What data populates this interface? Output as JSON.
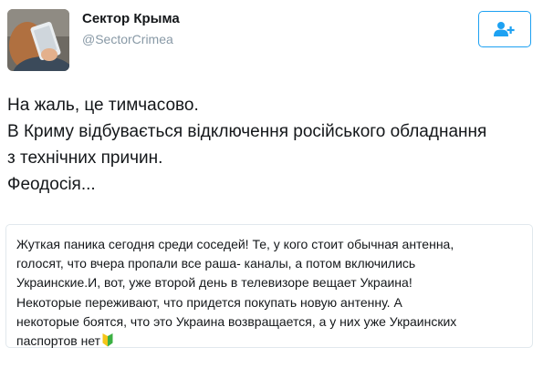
{
  "author": {
    "display_name": "Сектор Крыма",
    "handle": "@SectorCrimea"
  },
  "follow_button": {
    "icon": "add-user-icon",
    "color": "#1da1f2"
  },
  "tweet": {
    "lines": [
      "На жаль, це тимчасово.",
      "В Криму відбувається відключення російського обладнання",
      "з технічних причин.",
      "Феодосія..."
    ]
  },
  "quote": {
    "lines": [
      "Жуткая паника сегодня среди соседей! Те, у кого стоит обычная антенна,",
      "голосят, что вчера пропали все раша- каналы, а потом включились",
      "Украинские.И, вот, уже второй день в телевизоре вещает Украина!",
      "Некоторые переживают, что придется покупать новую антенну. А",
      "некоторые боятся, что это Украина возвращается, а у них уже Украинских",
      "паспортов нет"
    ],
    "trailing_icon": "beginner-badge-icon"
  }
}
